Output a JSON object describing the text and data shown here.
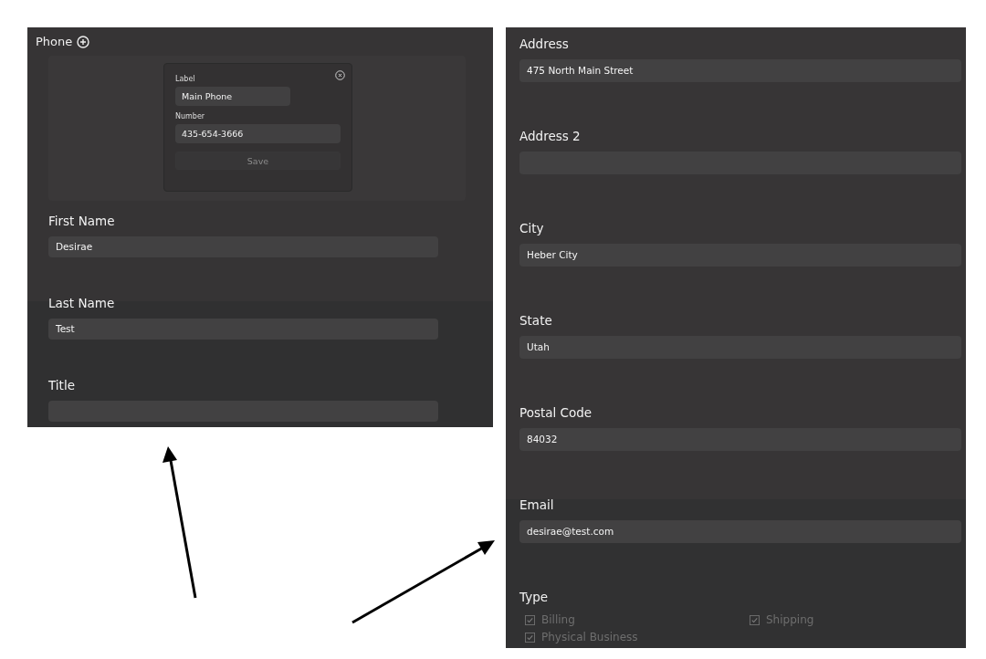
{
  "left_panel": {
    "phone_section": {
      "title": "Phone",
      "dialog": {
        "fields": [
          {
            "label": "Label",
            "value": "Main Phone",
            "kind": "short"
          },
          {
            "label": "Number",
            "value": "435-654-3666",
            "kind": "wide"
          }
        ],
        "save_button": {
          "label": "Save",
          "disabled": true
        }
      }
    },
    "fields": [
      {
        "label": "First Name",
        "value": "Desirae"
      },
      {
        "label": "Last Name",
        "value": "Test"
      },
      {
        "label": "Title"
      }
    ]
  },
  "right_panel": {
    "fields": [
      {
        "label": "Address",
        "value": "475 North Main Street"
      },
      {
        "label": "Address 2"
      },
      {
        "label": "City",
        "value": "Heber City"
      },
      {
        "label": "State",
        "value": "Utah"
      },
      {
        "label": "Postal Code",
        "value": "84032"
      },
      {
        "label": "Email",
        "value": "desirae@test.com"
      }
    ],
    "type": {
      "label": "Type",
      "options": [
        {
          "label": "Billing",
          "checked": true
        },
        {
          "label": "Shipping",
          "checked": true
        },
        {
          "label": "Physical Business",
          "checked": true
        }
      ]
    }
  }
}
